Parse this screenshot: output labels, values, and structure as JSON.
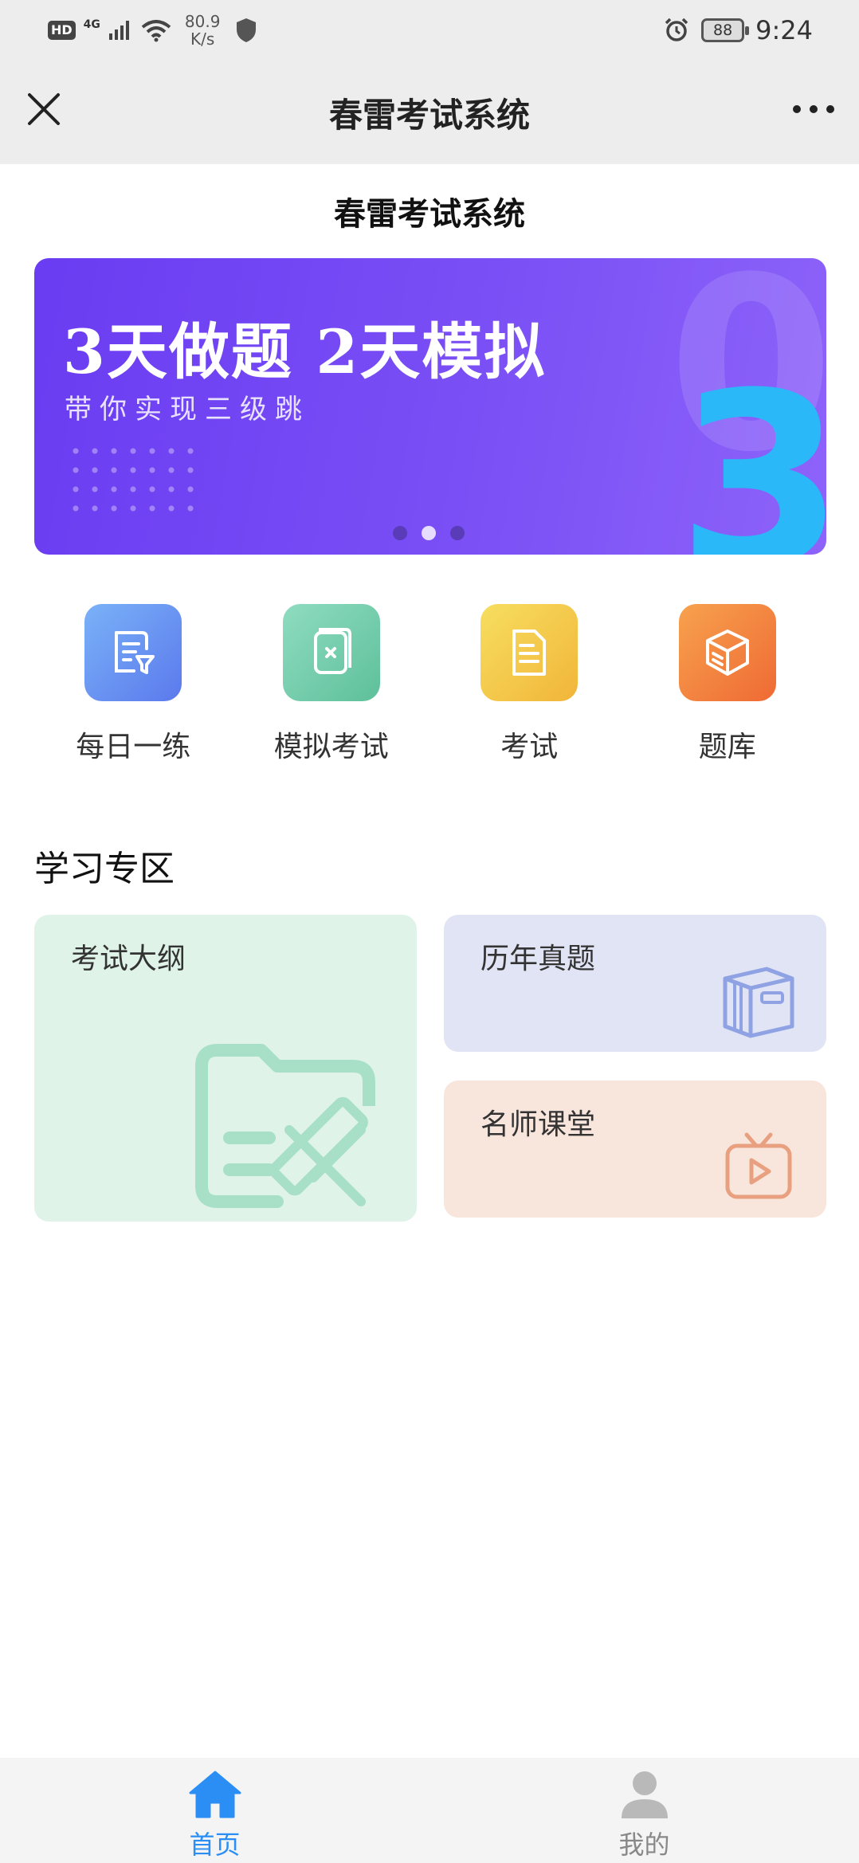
{
  "status_bar": {
    "hd": "HD",
    "network": "4G",
    "speed_value": "80.9",
    "speed_unit": "K/s",
    "battery": "88",
    "time": "9:24"
  },
  "nav": {
    "title": "春雷考试系统",
    "close_icon": "close-icon",
    "more_icon": "more-icon"
  },
  "page": {
    "heading": "春雷考试系统"
  },
  "banner": {
    "headline": "3天做题 2天模拟",
    "subtitle": "带你实现三级跳",
    "deco_zero": "0",
    "deco_three": "3",
    "slide_count": 3,
    "active_slide": 2
  },
  "quick_entries": [
    {
      "label": "每日一练",
      "icon": "daily-practice-icon",
      "color": "#5b79ec"
    },
    {
      "label": "模拟考试",
      "icon": "mock-exam-icon",
      "color": "#5ec09b"
    },
    {
      "label": "考试",
      "icon": "exam-icon",
      "color": "#f1b53a"
    },
    {
      "label": "题库",
      "icon": "question-bank-icon",
      "color": "#ef6a34"
    }
  ],
  "study_zone": {
    "title": "学习专区",
    "cards": [
      {
        "label": "考试大纲",
        "color": "#dff3e8"
      },
      {
        "label": "历年真题",
        "color": "#e0e4f4"
      },
      {
        "label": "名师课堂",
        "color": "#f8e6dd"
      }
    ]
  },
  "tab_bar": {
    "items": [
      {
        "label": "首页",
        "icon": "home-icon",
        "active": true
      },
      {
        "label": "我的",
        "icon": "profile-icon",
        "active": false
      }
    ],
    "active_color": "#2a8ef5"
  }
}
